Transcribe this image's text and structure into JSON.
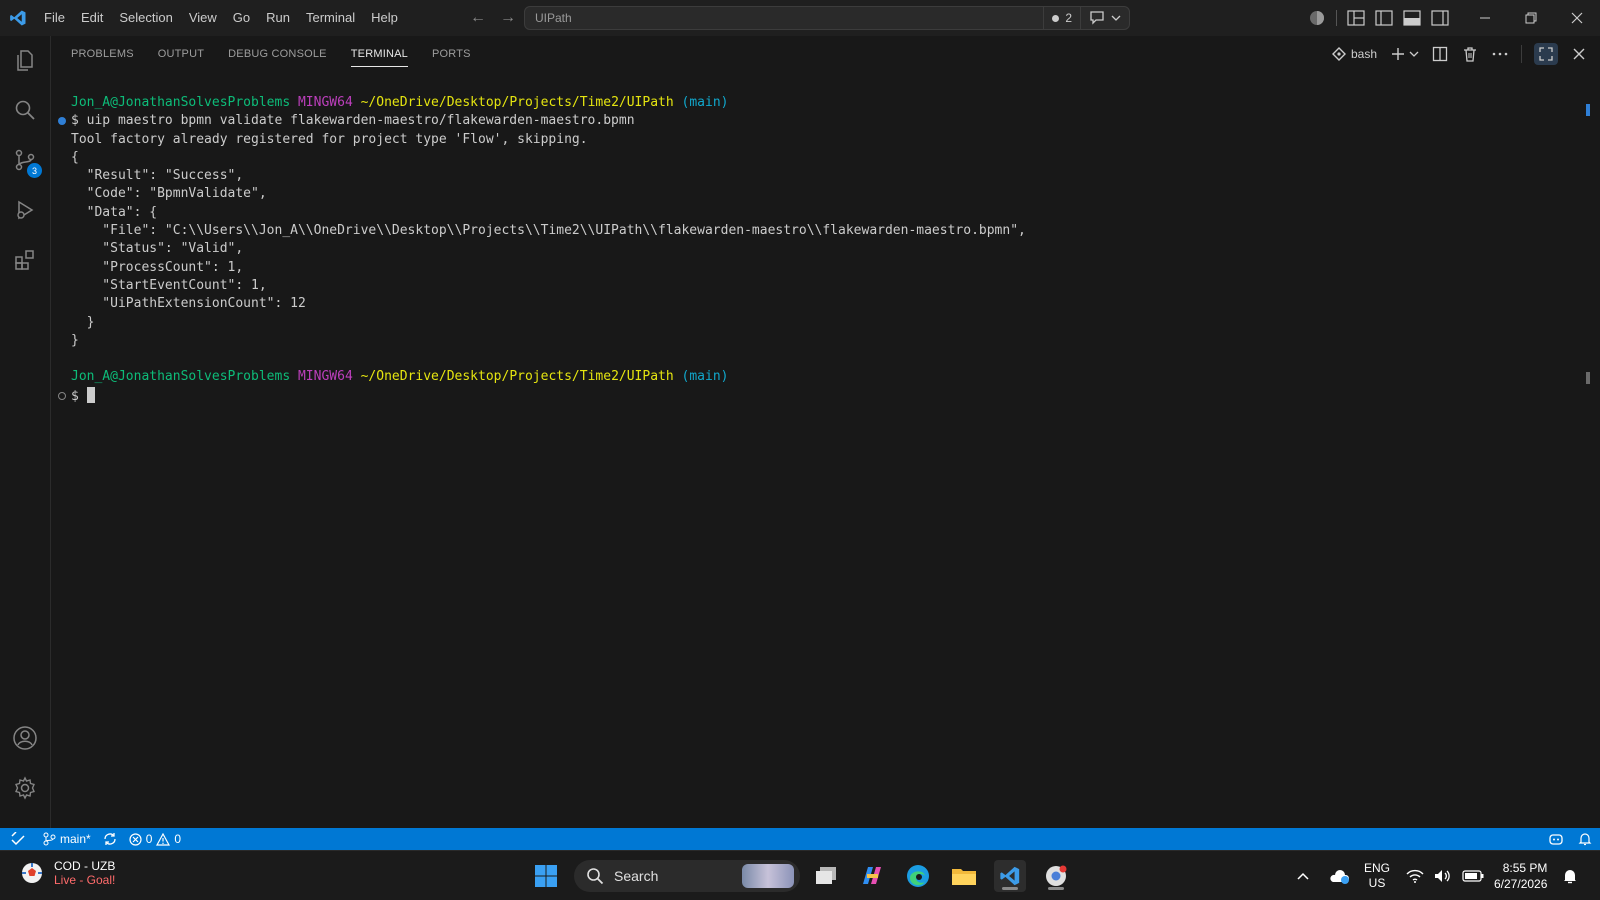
{
  "menu": [
    "File",
    "Edit",
    "Selection",
    "View",
    "Go",
    "Run",
    "Terminal",
    "Help"
  ],
  "command_center": {
    "text": "UIPath",
    "badge_count": "2"
  },
  "activity_bar": {
    "source_control_badge": "3"
  },
  "panel": {
    "tabs": [
      "PROBLEMS",
      "OUTPUT",
      "DEBUG CONSOLE",
      "TERMINAL",
      "PORTS"
    ],
    "active_tab": "TERMINAL",
    "shell_label": "bash"
  },
  "terminal": {
    "prompt1": {
      "user": "Jon_A@JonathanSolvesProblems",
      "env": "MINGW64",
      "path": "~/OneDrive/Desktop/Projects/Time2/UIPath",
      "branch": "(main)"
    },
    "command": "$ uip maestro bpmn validate flakewarden-maestro/flakewarden-maestro.bpmn",
    "output": [
      "Tool factory already registered for project type 'Flow', skipping.",
      "{",
      "  \"Result\": \"Success\",",
      "  \"Code\": \"BpmnValidate\",",
      "  \"Data\": {",
      "    \"File\": \"C:\\\\Users\\\\Jon_A\\\\OneDrive\\\\Desktop\\\\Projects\\\\Time2\\\\UIPath\\\\flakewarden-maestro\\\\flakewarden-maestro.bpmn\",",
      "    \"Status\": \"Valid\",",
      "    \"ProcessCount\": 1,",
      "    \"StartEventCount\": 1,",
      "    \"UiPathExtensionCount\": 12",
      "  }",
      "}"
    ],
    "prompt2": {
      "user": "Jon_A@JonathanSolvesProblems",
      "env": "MINGW64",
      "path": "~/OneDrive/Desktop/Projects/Time2/UIPath",
      "branch": "(main)"
    },
    "prompt_symbol": "$"
  },
  "statusbar": {
    "branch": "main*",
    "errors": "0",
    "warnings": "0"
  },
  "taskbar": {
    "weather_title": "COD - UZB",
    "weather_sub": "Live - Goal!",
    "search_label": "Search",
    "lang_top": "ENG",
    "lang_bottom": "US",
    "time": "8:55 PM",
    "date": "6/27/2026"
  },
  "colors": {
    "accent": "#0078d4",
    "prompt_user": "#23d18b",
    "prompt_env": "#bc3fbc",
    "prompt_path": "#e5e510",
    "prompt_branch": "#11a8cd"
  }
}
